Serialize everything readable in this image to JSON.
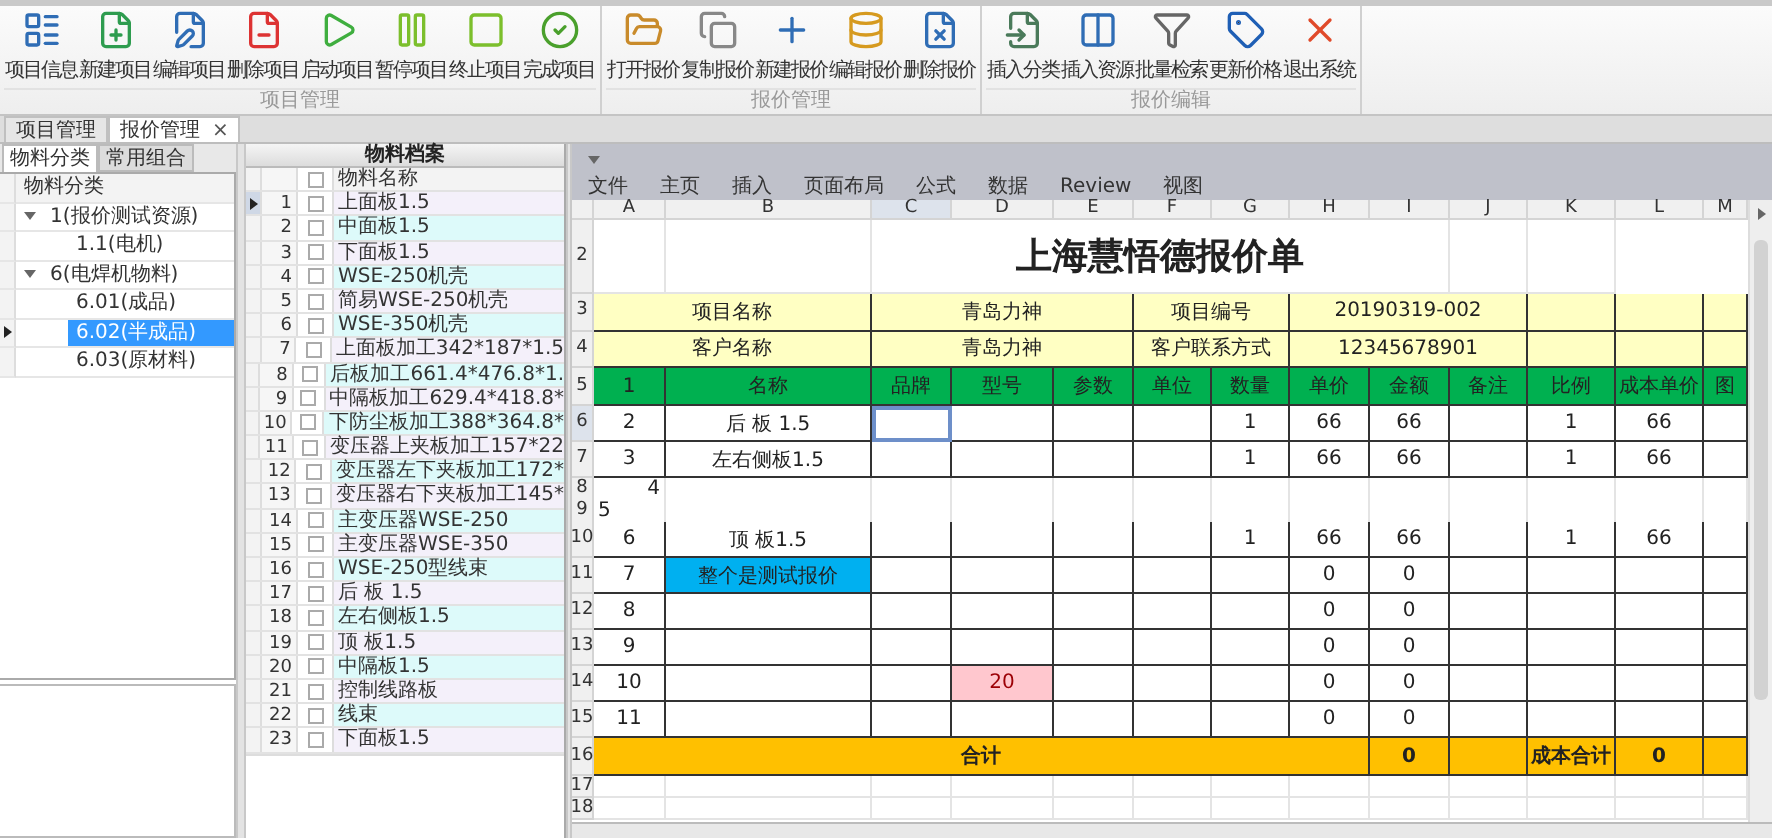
{
  "ribbon": {
    "groups": [
      {
        "label": "项目管理",
        "buttons": [
          "项目信息",
          "新建项目",
          "编辑项目",
          "删除项目",
          "启动项目",
          "暂停项目",
          "终止项目",
          "完成项目"
        ]
      },
      {
        "label": "报价管理",
        "buttons": [
          "打开报价",
          "复制报价",
          "新建报价",
          "编辑报价",
          "删除报价"
        ]
      },
      {
        "label": "报价编辑",
        "buttons": [
          "插入分类",
          "插入资源",
          "批量检索",
          "更新价格",
          "退出系统"
        ]
      }
    ]
  },
  "document_tabs": [
    {
      "label": "项目管理",
      "selected": false
    },
    {
      "label": "报价管理",
      "selected": true,
      "close": "×"
    }
  ],
  "category_panel": {
    "tabs": [
      {
        "label": "物料分类",
        "selected": true
      },
      {
        "label": "常用组合",
        "selected": false
      }
    ],
    "header": "物料分类",
    "tree": [
      {
        "label": "1(报价测试资源)",
        "expanded": true,
        "selected": false,
        "children": [
          {
            "label": "1.1(电机)",
            "selected": false
          }
        ]
      },
      {
        "label": "6(电焊机物料)",
        "expanded": true,
        "selected": false,
        "children": [
          {
            "label": "6.01(成品)",
            "selected": false
          },
          {
            "label": "6.02(半成品)",
            "selected": true
          },
          {
            "label": "6.03(原材料)",
            "selected": false
          }
        ]
      }
    ]
  },
  "material_panel": {
    "title": "物料档案",
    "header_checked": false,
    "column": "物料名称",
    "rows": [
      {
        "number": "1",
        "checked": false,
        "name": "上面板1.5",
        "selected": true
      },
      {
        "number": "2",
        "checked": false,
        "name": "中面板1.5",
        "selected": false
      },
      {
        "number": "3",
        "checked": false,
        "name": "下面板1.5",
        "selected": false
      },
      {
        "number": "4",
        "checked": false,
        "name": "WSE-250机壳",
        "selected": false
      },
      {
        "number": "5",
        "checked": false,
        "name": "简易WSE-250机壳",
        "selected": false
      },
      {
        "number": "6",
        "checked": false,
        "name": "WSE-350机壳",
        "selected": false
      },
      {
        "number": "7",
        "checked": false,
        "name": "上面板加工342*187*1.5",
        "selected": false
      },
      {
        "number": "8",
        "checked": false,
        "name": "后板加工661.4*476.8*1.",
        "selected": false
      },
      {
        "number": "9",
        "checked": false,
        "name": "中隔板加工629.4*418.8*",
        "selected": false
      },
      {
        "number": "10",
        "checked": false,
        "name": "下防尘板加工388*364.8*",
        "selected": false
      },
      {
        "number": "11",
        "checked": false,
        "name": "变压器上夹板加工157*22",
        "selected": false
      },
      {
        "number": "12",
        "checked": false,
        "name": "变压器左下夹板加工172*",
        "selected": false
      },
      {
        "number": "13",
        "checked": false,
        "name": "变压器右下夹板加工145*",
        "selected": false
      },
      {
        "number": "14",
        "checked": false,
        "name": "主变压器WSE-250",
        "selected": false
      },
      {
        "number": "15",
        "checked": false,
        "name": "主变压器WSE-350",
        "selected": false
      },
      {
        "number": "16",
        "checked": false,
        "name": "WSE-250型线束",
        "selected": false
      },
      {
        "number": "17",
        "checked": false,
        "name": "后  板 1.5",
        "selected": false
      },
      {
        "number": "18",
        "checked": false,
        "name": "左右侧板1.5",
        "selected": false
      },
      {
        "number": "19",
        "checked": false,
        "name": "顶  板1.5",
        "selected": false
      },
      {
        "number": "20",
        "checked": false,
        "name": "中隔板1.5",
        "selected": false
      },
      {
        "number": "21",
        "checked": false,
        "name": "控制线路板",
        "selected": false
      },
      {
        "number": "22",
        "checked": false,
        "name": "线束",
        "selected": false
      },
      {
        "number": "23",
        "checked": false,
        "name": "下面板1.5",
        "selected": false
      }
    ]
  },
  "spreadsheet": {
    "menu": [
      "文件",
      "主页",
      "插入",
      "页面布局",
      "公式",
      "数据",
      "Review",
      "视图"
    ],
    "columns": [
      "A",
      "B",
      "C",
      "D",
      "E",
      "F",
      "G",
      "H",
      "I",
      "J",
      "K",
      "L",
      "M"
    ],
    "rows": [
      {
        "number": "2",
        "kind": "title",
        "cells": [
          {},
          {},
          {
            "text": "上海慧悟德报价单"
          },
          {},
          {}
        ]
      },
      {
        "number": "3",
        "kind": "info",
        "cells": [
          {
            "text": "项目名称"
          },
          {
            "text": "青岛力神"
          },
          {
            "text": "项目编号"
          },
          {
            "text": "20190319-002"
          },
          {},
          {},
          {}
        ]
      },
      {
        "number": "4",
        "kind": "info",
        "cells": [
          {
            "text": "客户名称"
          },
          {
            "text": "青岛力神"
          },
          {
            "text": "客户联系方式"
          },
          {
            "text": "12345678901"
          },
          {},
          {},
          {}
        ]
      },
      {
        "number": "5",
        "kind": "header",
        "cells": [
          {
            "text": "1"
          },
          {
            "text": "名称"
          },
          {
            "text": "品牌"
          },
          {
            "text": "型号"
          },
          {
            "text": "参数"
          },
          {
            "text": "单位"
          },
          {
            "text": "数量"
          },
          {
            "text": "单价"
          },
          {
            "text": "金额"
          },
          {
            "text": "备注"
          },
          {
            "text": "比例"
          },
          {
            "text": "成本单价"
          },
          {
            "text": "图"
          }
        ]
      },
      {
        "number": "6",
        "kind": "item",
        "cells": [
          {
            "text": "2",
            "selected": false
          },
          {
            "text": "后  板 1.5",
            "selected": false
          },
          {
            "selected": true
          },
          {
            "selected": false
          },
          {
            "selected": false
          },
          {
            "selected": false
          },
          {
            "text": "1",
            "selected": false
          },
          {
            "text": "66",
            "selected": false
          },
          {
            "text": "66",
            "selected": false
          },
          {
            "selected": false
          },
          {
            "text": "1",
            "selected": false
          },
          {
            "text": "66",
            "selected": false
          },
          {
            "selected": false
          }
        ]
      },
      {
        "number": "7",
        "kind": "item",
        "cells": [
          {
            "text": "3",
            "selected": false
          },
          {
            "text": "左右侧板1.5",
            "selected": false
          },
          {
            "selected": false
          },
          {
            "selected": false
          },
          {
            "selected": false
          },
          {
            "selected": false
          },
          {
            "text": "1",
            "selected": false
          },
          {
            "text": "66",
            "selected": false
          },
          {
            "text": "66",
            "selected": false
          },
          {
            "selected": false
          },
          {
            "text": "1",
            "selected": false
          },
          {
            "text": "66",
            "selected": false
          },
          {
            "selected": false
          }
        ]
      },
      {
        "number": "8",
        "kind": "overflow",
        "cells": [
          {
            "text": "4"
          }
        ]
      },
      {
        "number": "9",
        "kind": "stub",
        "cells": [
          {
            "text": "5"
          }
        ]
      },
      {
        "number": "10",
        "kind": "item",
        "cells": [
          {
            "text": "6",
            "selected": false
          },
          {
            "text": "顶  板1.5",
            "selected": false
          },
          {
            "selected": false
          },
          {
            "selected": false
          },
          {
            "selected": false
          },
          {
            "selected": false
          },
          {
            "text": "1",
            "selected": false
          },
          {
            "text": "66",
            "selected": false
          },
          {
            "text": "66",
            "selected": false
          },
          {
            "selected": false
          },
          {
            "text": "1",
            "selected": false
          },
          {
            "text": "66",
            "selected": false
          },
          {
            "selected": false
          }
        ]
      },
      {
        "number": "11",
        "kind": "item",
        "cells": [
          {
            "text": "7",
            "selected": false
          },
          {
            "text": "整个是测试报价",
            "selected": false,
            "color": "#00b0f0"
          },
          {
            "selected": false
          },
          {
            "selected": false
          },
          {
            "selected": false
          },
          {
            "selected": false
          },
          {
            "selected": false
          },
          {
            "text": "0",
            "selected": false
          },
          {
            "text": "0",
            "selected": false
          },
          {
            "selected": false
          },
          {
            "selected": false
          },
          {
            "selected": false
          },
          {
            "selected": false
          }
        ]
      },
      {
        "number": "12",
        "kind": "item",
        "cells": [
          {
            "text": "8",
            "selected": false
          },
          {
            "selected": false
          },
          {
            "selected": false
          },
          {
            "selected": false
          },
          {
            "selected": false
          },
          {
            "selected": false
          },
          {
            "selected": false
          },
          {
            "text": "0",
            "selected": false
          },
          {
            "text": "0",
            "selected": false
          },
          {
            "selected": false
          },
          {
            "selected": false
          },
          {
            "selected": false
          },
          {
            "selected": false
          }
        ]
      },
      {
        "number": "13",
        "kind": "item",
        "cells": [
          {
            "text": "9",
            "selected": false
          },
          {
            "selected": false
          },
          {
            "selected": false
          },
          {
            "selected": false
          },
          {
            "selected": false
          },
          {
            "selected": false
          },
          {
            "selected": false
          },
          {
            "text": "0",
            "selected": false
          },
          {
            "text": "0",
            "selected": false
          },
          {
            "selected": false
          },
          {
            "selected": false
          },
          {
            "selected": false
          },
          {
            "selected": false
          }
        ]
      },
      {
        "number": "14",
        "kind": "item",
        "cells": [
          {
            "text": "10",
            "selected": false
          },
          {
            "selected": false
          },
          {
            "selected": false
          },
          {
            "text": "20",
            "selected": false,
            "color": "#ffc7ce"
          },
          {
            "selected": false
          },
          {
            "selected": false
          },
          {
            "selected": false
          },
          {
            "text": "0",
            "selected": false
          },
          {
            "text": "0",
            "selected": false
          },
          {
            "selected": false
          },
          {
            "selected": false
          },
          {
            "selected": false
          },
          {
            "selected": false
          }
        ]
      },
      {
        "number": "15",
        "kind": "item",
        "cells": [
          {
            "text": "11",
            "selected": false
          },
          {
            "selected": false
          },
          {
            "selected": false
          },
          {
            "selected": false
          },
          {
            "selected": false
          },
          {
            "selected": false
          },
          {
            "selected": false
          },
          {
            "text": "0",
            "selected": false
          },
          {
            "text": "0",
            "selected": false
          },
          {
            "selected": false
          },
          {
            "selected": false
          },
          {
            "selected": false
          },
          {
            "selected": false
          }
        ]
      },
      {
        "number": "16",
        "kind": "total",
        "cells": [
          {
            "text": "合计"
          },
          {},
          {},
          {},
          {},
          {},
          {},
          {},
          {
            "text": "0"
          },
          {},
          {
            "text": "成本合计"
          },
          {
            "text": "0"
          },
          {}
        ]
      },
      {
        "number": "17",
        "kind": "empty",
        "cells": []
      },
      {
        "number": "18",
        "kind": "empty",
        "cells": []
      }
    ]
  }
}
